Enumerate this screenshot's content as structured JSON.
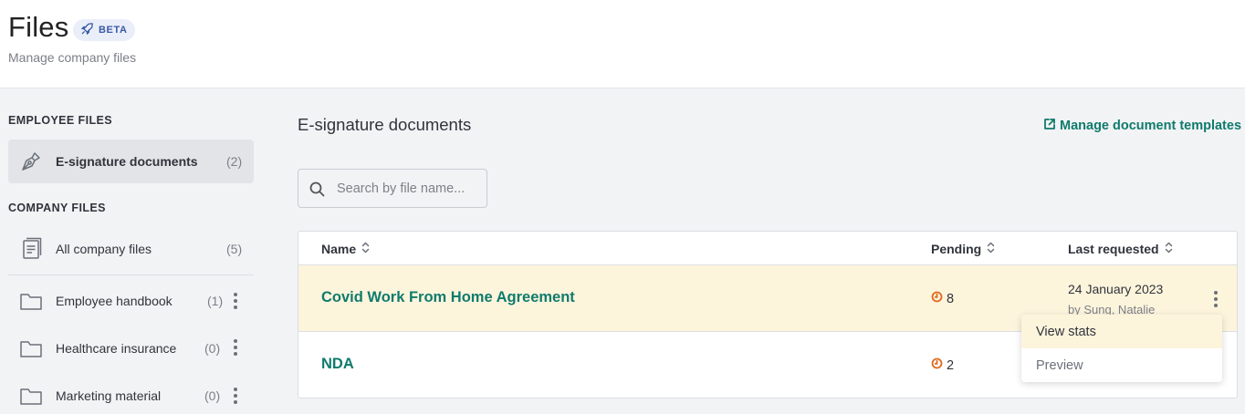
{
  "header": {
    "title": "Files",
    "badge": "BETA",
    "subtitle": "Manage company files"
  },
  "sidebar": {
    "employee_heading": "EMPLOYEE FILES",
    "company_heading": "COMPANY FILES",
    "employee_items": [
      {
        "label": "E-signature documents",
        "count": "(2)",
        "icon": "pen-nib-icon"
      }
    ],
    "company_items": [
      {
        "label": "All company files",
        "count": "(5)",
        "icon": "document-icon"
      },
      {
        "label": "Employee handbook",
        "count": "(1)",
        "icon": "folder-icon"
      },
      {
        "label": "Healthcare insurance",
        "count": "(0)",
        "icon": "folder-icon"
      },
      {
        "label": "Marketing material",
        "count": "(0)",
        "icon": "folder-icon"
      }
    ]
  },
  "main": {
    "title": "E-signature documents",
    "manage_link": "Manage document templates",
    "search": {
      "placeholder": "Search by file name..."
    },
    "table": {
      "columns": [
        "Name",
        "Pending",
        "Last requested"
      ],
      "rows": [
        {
          "name": "Covid Work From Home Agreement",
          "pending": "8",
          "date": "24 January 2023",
          "by": "by Sung, Natalie"
        },
        {
          "name": "NDA",
          "pending": "2",
          "date": "",
          "by": ""
        }
      ]
    },
    "context_menu": {
      "items": [
        "View stats",
        "Preview"
      ]
    }
  },
  "colors": {
    "accent": "#0f7b6c",
    "pending_icon": "#e06a1b",
    "row_highlight": "#fdf4dc",
    "badge_bg": "#eaeef9"
  }
}
